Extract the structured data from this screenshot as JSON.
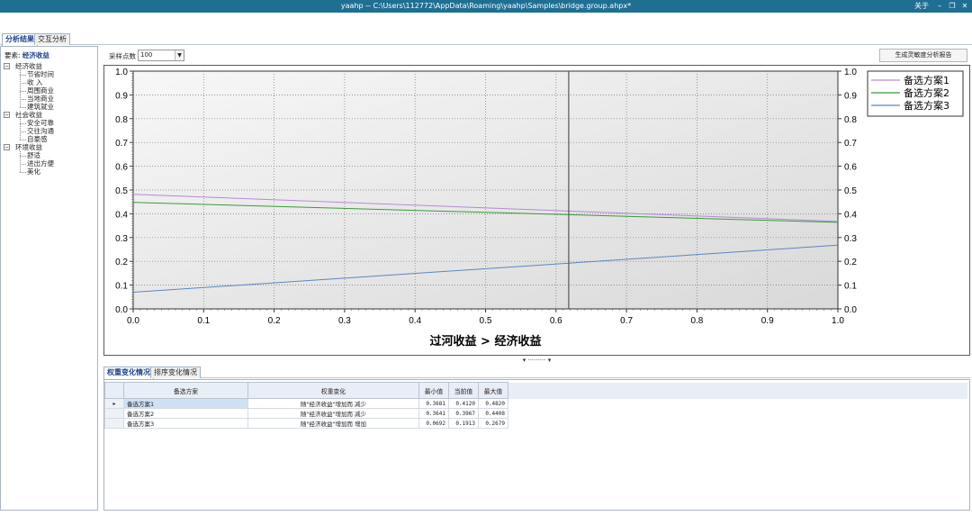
{
  "window": {
    "title": "yaahp -- C:\\Users\\112772\\AppData\\Roaming\\yaahp\\Samples\\bridge.group.ahpx*",
    "about": "关于",
    "minimize": "–",
    "restore": "❐",
    "close": "✕"
  },
  "tabs": [
    {
      "label": "分析结果",
      "active": true
    },
    {
      "label": "交互分析",
      "active": false
    }
  ],
  "left_panel": {
    "factor_label": "要素:",
    "factor_value": "经济收益",
    "tree": [
      {
        "label": "经济收益",
        "children": [
          "节省时间",
          "收 入",
          "周围商业",
          "当地商业",
          "建筑就业"
        ]
      },
      {
        "label": "社会收益",
        "children": [
          "安全可靠",
          "交往沟通",
          "自豪感"
        ]
      },
      {
        "label": "环境收益",
        "children": [
          "舒适",
          "进出方便",
          "美化"
        ]
      }
    ]
  },
  "toolbar": {
    "sample_label": "采样点数",
    "sample_value": "100",
    "report_button": "生成灵敏度分析报告"
  },
  "chart_data": {
    "type": "line",
    "xlabel": "过河收益 > 经济收益",
    "xlim": [
      0.0,
      1.0
    ],
    "ylim": [
      0.0,
      1.0
    ],
    "x_ticks": [
      "0.0",
      "0.1",
      "0.2",
      "0.3",
      "0.4",
      "0.5",
      "0.6",
      "0.7",
      "0.8",
      "0.9",
      "1.0"
    ],
    "y_ticks": [
      "0.0",
      "0.1",
      "0.2",
      "0.3",
      "0.4",
      "0.5",
      "0.6",
      "0.7",
      "0.8",
      "0.9",
      "1.0"
    ],
    "grid": true,
    "legend": "top-right",
    "current_x": 0.618,
    "series": [
      {
        "name": "备选方案1",
        "color": "#b58ad6",
        "x": [
          0,
          1
        ],
        "y": [
          0.482,
          0.368
        ]
      },
      {
        "name": "备选方案2",
        "color": "#3a9a3a",
        "x": [
          0,
          1
        ],
        "y": [
          0.448,
          0.364
        ]
      },
      {
        "name": "备选方案3",
        "color": "#5b86c2",
        "x": [
          0,
          1
        ],
        "y": [
          0.07,
          0.268
        ]
      }
    ]
  },
  "bottom_tabs": [
    {
      "label": "权重变化情况",
      "active": true
    },
    {
      "label": "排序变化情况",
      "active": false
    }
  ],
  "table": {
    "headers": [
      "备选方案",
      "权重变化",
      "最小值",
      "当前值",
      "最大值"
    ],
    "rows": [
      {
        "name": "备选方案1",
        "change": "随\"经济收益\"增加而 减少",
        "min": "0.3681",
        "cur": "0.4120",
        "max": "0.4820"
      },
      {
        "name": "备选方案2",
        "change": "随\"经济收益\"增加而 减少",
        "min": "0.3641",
        "cur": "0.3967",
        "max": "0.4408"
      },
      {
        "name": "备选方案3",
        "change": "随\"经济收益\"增加而 增加",
        "min": "0.0692",
        "cur": "0.1913",
        "max": "0.2679"
      }
    ]
  }
}
